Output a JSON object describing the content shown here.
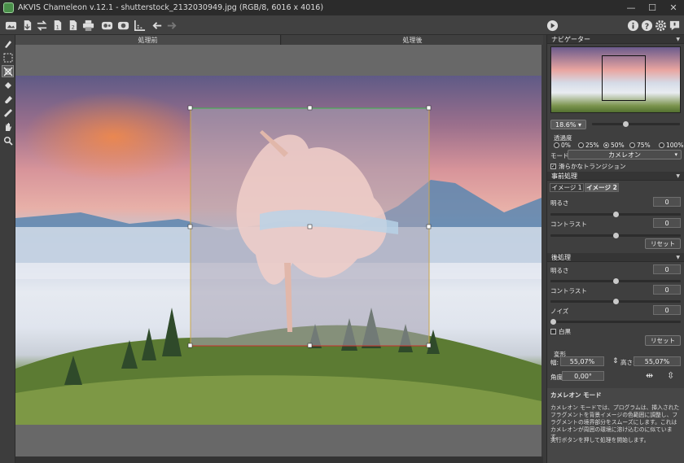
{
  "window": {
    "title": "AKVIS Chameleon v.12.1 - shutterstock_2132030949.jpg (RGB/8, 6016 x 4016)"
  },
  "tabs": {
    "before": "処理前",
    "after": "処理後"
  },
  "navigator": {
    "title": "ナビゲーター",
    "zoom": "18.6% ▾",
    "zoom_fraction": 0.38
  },
  "transparency": {
    "title": "透過度",
    "options": [
      "0%",
      "25%",
      "50%",
      "75%",
      "100%"
    ],
    "selected": "50%"
  },
  "mode": {
    "label": "モード",
    "value": "カメレオン",
    "arrow": "▾"
  },
  "smooth_transition": {
    "label": "滑らかなトランジション",
    "checked": true
  },
  "preprocessing": {
    "title": "事前処理",
    "tabs": [
      "イメージ 1",
      "イメージ 2"
    ],
    "active_tab": "イメージ 2",
    "brightness_label": "明るさ",
    "brightness_value": "0",
    "brightness_fraction": 0.5,
    "contrast_label": "コントラスト",
    "contrast_value": "0",
    "contrast_fraction": 0.5,
    "reset": "リセット"
  },
  "postprocessing": {
    "title": "後処理",
    "brightness_label": "明るさ",
    "brightness_value": "0",
    "brightness_fraction": 0.5,
    "contrast_label": "コントラスト",
    "contrast_value": "0",
    "contrast_fraction": 0.5,
    "noise_label": "ノイズ",
    "noise_value": "0",
    "noise_fraction": 0.0,
    "bw_label": "白黒",
    "bw_checked": false,
    "reset": "リセット"
  },
  "transform": {
    "title": "変形",
    "width_label": "幅:",
    "width_value": "55,07%",
    "height_label": "高さ:",
    "height_value": "55,07%",
    "angle_label": "角度:",
    "angle_value": "0,00°"
  },
  "info": {
    "title": "カメレオン モード",
    "text": "カメレオン モードでは、プログラムは、挿入されたフラグメントを背景イメージの色範囲に調整し、フラグメントの境界部分をスムーズにします。これはカメレオンが周囲の環境に溶け込むのに似ています。",
    "hint": "実行ボタンを押して処理を開始します。"
  },
  "colors": {
    "selection_top": "#3bb34a",
    "selection_bottom": "#c9302c",
    "handle": "#ffffff"
  }
}
